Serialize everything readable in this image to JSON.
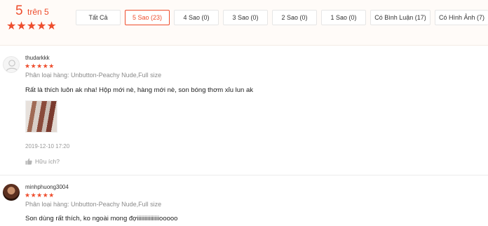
{
  "overview": {
    "score": "5",
    "score_suffix": "trên 5",
    "stars": "★★★★★",
    "filters": [
      {
        "label": "Tất Cả",
        "active": false
      },
      {
        "label": "5 Sao (23)",
        "active": true
      },
      {
        "label": "4 Sao (0)",
        "active": false
      },
      {
        "label": "3 Sao (0)",
        "active": false
      },
      {
        "label": "2 Sao (0)",
        "active": false
      },
      {
        "label": "1 Sao (0)",
        "active": false
      },
      {
        "label": "Có Bình Luận (17)",
        "active": false
      },
      {
        "label": "Có Hình Ảnh (7)",
        "active": false
      }
    ]
  },
  "reviews": [
    {
      "username": "thudarkkk",
      "rating": 5,
      "stars": "★★★★★",
      "variation": "Phân loại hàng: Unbutton-Peachy Nude,Full size",
      "comment": "Rất là thích luôn ak nha! Hộp mới nè, hàng mới nè, son bóng thơm xỉu lun ak",
      "time": "2019-12-10 17:20",
      "helpful": "Hữu ích?"
    },
    {
      "username": "minhphuong3004",
      "rating": 5,
      "stars": "★★★★★",
      "variation": "Phân loại hàng: Unbutton-Peachy Nude,Full size",
      "comment": "Son dùng rất thích, ko ngoài mong đợiiiiiiiiiiiiiiiooooo"
    }
  ]
}
